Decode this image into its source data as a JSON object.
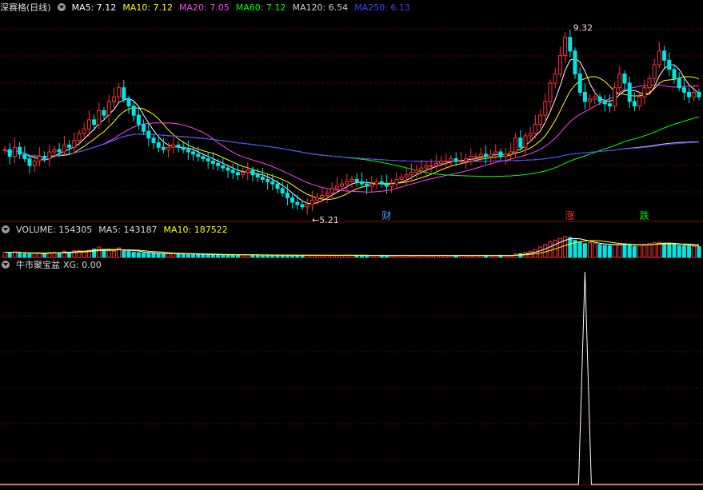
{
  "main_header": {
    "title": "深赛格(日线)",
    "ma": [
      {
        "label": "MA5: 7.12",
        "color": "#ffffff"
      },
      {
        "label": "MA10: 7.12",
        "color": "#ffff00"
      },
      {
        "label": "MA20: 7.05",
        "color": "#ff40ff"
      },
      {
        "label": "MA60: 7.12",
        "color": "#00ff00"
      },
      {
        "label": "MA120: 6.54",
        "color": "#cccccc"
      },
      {
        "label": "MA250: 6.13",
        "color": "#4040ff"
      }
    ]
  },
  "volume_header": {
    "title": "VOLUME: 154305",
    "ma5": "MA5: 143187",
    "ma10": "MA10: 187522",
    "ma10_color": "#ffff00"
  },
  "indicator_header": {
    "title": "牛市聚宝盆",
    "xg": "XG: 0.00"
  },
  "colors": {
    "up": "#ff3232",
    "down": "#00e5e5",
    "grid": "#5a0000",
    "signal": "#ffffff"
  },
  "chart_data": [
    {
      "type": "candlestick",
      "ylim": [
        5.0,
        9.5
      ],
      "high_label": "9.32",
      "low_label": "5.21",
      "markers": [
        {
          "text": "财",
          "index": 77,
          "color": "#4aa0ff"
        },
        {
          "text": "涨",
          "index": 114,
          "color": "#ff3232"
        },
        {
          "text": "跌",
          "index": 129,
          "color": "#00ee00"
        }
      ],
      "closes": [
        6.55,
        6.4,
        6.6,
        6.45,
        6.35,
        6.2,
        6.3,
        6.4,
        6.35,
        6.5,
        6.55,
        6.5,
        6.65,
        6.6,
        6.75,
        6.9,
        7.0,
        7.2,
        7.1,
        7.4,
        7.3,
        7.6,
        7.7,
        7.9,
        7.65,
        7.5,
        7.3,
        7.1,
        6.95,
        6.8,
        6.7,
        6.6,
        6.55,
        6.6,
        6.65,
        6.6,
        6.55,
        6.5,
        6.45,
        6.4,
        6.35,
        6.3,
        6.25,
        6.2,
        6.15,
        6.1,
        6.05,
        6.0,
        6.05,
        6.1,
        6.0,
        5.95,
        5.9,
        5.85,
        5.8,
        5.7,
        5.6,
        5.5,
        5.4,
        5.35,
        5.3,
        5.35,
        5.45,
        5.5,
        5.55,
        5.6,
        5.7,
        5.75,
        5.8,
        5.85,
        5.9,
        5.85,
        5.8,
        5.75,
        5.8,
        5.85,
        5.8,
        5.75,
        5.8,
        5.9,
        5.95,
        6.0,
        6.05,
        6.1,
        6.15,
        6.2,
        6.2,
        6.25,
        6.3,
        6.3,
        6.35,
        6.3,
        6.3,
        6.35,
        6.4,
        6.4,
        6.45,
        6.4,
        6.45,
        6.5,
        6.4,
        6.45,
        6.5,
        6.8,
        6.6,
        6.85,
        6.9,
        7.1,
        7.3,
        7.6,
        8.0,
        8.2,
        8.6,
        9.0,
        8.7,
        8.2,
        7.8,
        7.6,
        7.65,
        7.7,
        7.6,
        7.55,
        7.5,
        7.9,
        8.2,
        8.0,
        7.6,
        7.5,
        7.7,
        7.9,
        8.1,
        8.4,
        8.7,
        8.5,
        8.3,
        8.1,
        7.9,
        7.8,
        7.7,
        7.8,
        7.7
      ]
    },
    {
      "type": "bar",
      "name": "VOLUME",
      "values": [
        30,
        28,
        32,
        25,
        22,
        20,
        24,
        26,
        22,
        28,
        30,
        27,
        35,
        30,
        38,
        40,
        36,
        42,
        48,
        60,
        44,
        38,
        36,
        55,
        40,
        35,
        30,
        28,
        26,
        25,
        24,
        22,
        20,
        22,
        24,
        21,
        20,
        19,
        18,
        17,
        18,
        16,
        15,
        16,
        15,
        14,
        16,
        15,
        14,
        15,
        13,
        14,
        13,
        12,
        13,
        14,
        12,
        13,
        12,
        11,
        12,
        13,
        12,
        11,
        12,
        13,
        12,
        11,
        12,
        13,
        12,
        11,
        12,
        11,
        10,
        11,
        12,
        11,
        10,
        11,
        12,
        11,
        10,
        11,
        12,
        11,
        10,
        11,
        12,
        11,
        10,
        11,
        12,
        11,
        10,
        11,
        12,
        11,
        10,
        11,
        12,
        11,
        10,
        20,
        22,
        30,
        35,
        45,
        60,
        75,
        90,
        100,
        110,
        120,
        115,
        100,
        90,
        80,
        85,
        80,
        75,
        70,
        68,
        75,
        80,
        78,
        70,
        65,
        72,
        76,
        80,
        85,
        88,
        82,
        78,
        74,
        70,
        68,
        66,
        64,
        62
      ]
    },
    {
      "type": "line",
      "name": "XG",
      "signal_index": 117,
      "signal_value": 1.0,
      "ylim": [
        0,
        1
      ]
    }
  ]
}
